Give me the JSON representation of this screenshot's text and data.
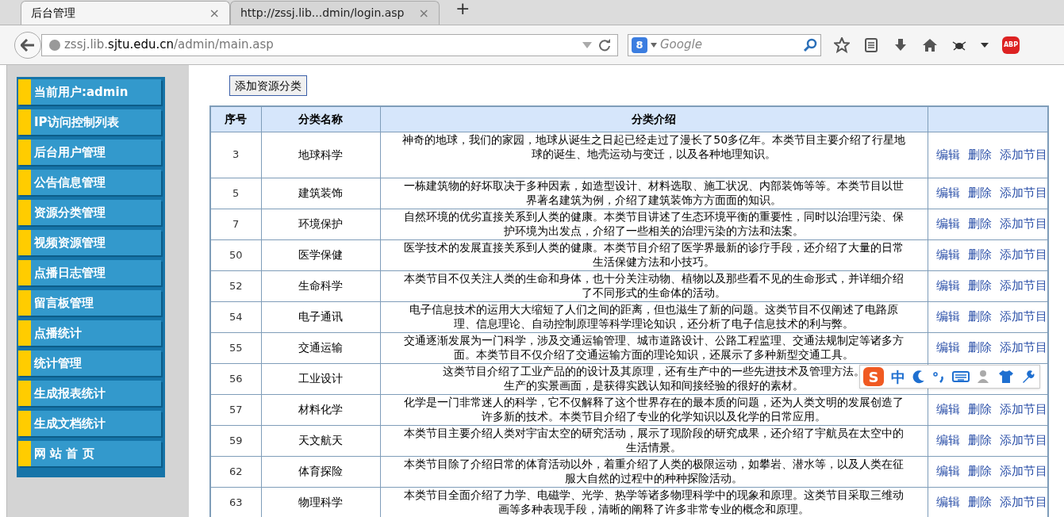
{
  "browser": {
    "tabs": [
      {
        "title": "后台管理",
        "selected": true,
        "close": "×"
      },
      {
        "title": "http://zssj.lib...dmin/login.asp",
        "selected": false,
        "close": "×"
      }
    ],
    "new_tab": "+",
    "address": {
      "prefix": "zssj.lib.",
      "domain": "sjtu.edu.cn",
      "path": "/admin/main.asp"
    },
    "search": {
      "engine": "8",
      "placeholder": "Google"
    },
    "adblock": "ABP"
  },
  "sidebar": {
    "items": [
      "当前用户:admin",
      "IP访问控制列表",
      "后台用户管理",
      "公告信息管理",
      "资源分类管理",
      "视频资源管理",
      "点播日志管理",
      "留言板管理",
      "点播统计",
      "统计管理",
      "生成报表统计",
      "生成文档统计",
      "网 站 首 页"
    ]
  },
  "add_button": "添加资源分类",
  "table": {
    "columns": [
      "序号",
      "分类名称",
      "分类介绍"
    ],
    "rows": [
      {
        "id": "3",
        "name": "地球科学",
        "lines": [
          "神奇的地球，我们的家园，地球从诞生之日起已经走过了漫长了50多亿年。本类节目主要介绍了行星地",
          "球的诞生、地壳运动与变迁，以及各种地理知识。"
        ],
        "actions": [
          "编辑",
          "删除",
          "添加节目"
        ]
      },
      {
        "id": "5",
        "name": "建筑装饰",
        "lines": [
          "一栋建筑物的好坏取决于多种因素，如造型设计、材料选取、施工状况、内部装饰等等。本类节目以世",
          "界著名建筑为例，介绍了建筑装饰方方面面的知识。"
        ],
        "actions": [
          "编辑",
          "删除",
          "添加节目"
        ]
      },
      {
        "id": "7",
        "name": "环境保护",
        "lines": [
          "自然环境的优劣直接关系到人类的健康。本类节目讲述了生态环境平衡的重要性，同时以治理污染、保",
          "护环境为出发点，介绍了一些相关的治理污染的方法和法案。"
        ],
        "actions": [
          "编辑",
          "删除",
          "添加节目"
        ]
      },
      {
        "id": "50",
        "name": "医学保健",
        "lines": [
          "医学技术的发展直接关系到人类的健康。本类节目介绍了医学界最新的诊疗手段，还介绍了大量的日常",
          "生活保健方法和小技巧。"
        ],
        "actions": [
          "编辑",
          "删除",
          "添加节目"
        ]
      },
      {
        "id": "52",
        "name": "生命科学",
        "lines": [
          "本类节目不仅关注人类的生命和身体，也十分关注动物、植物以及那些看不见的生命形式，并详细介绍",
          "了不同形式的生命体的活动。"
        ],
        "actions": [
          "编辑",
          "删除",
          "添加节目"
        ]
      },
      {
        "id": "54",
        "name": "电子通讯",
        "lines": [
          "电子信息技术的运用大大缩短了人们之间的距离，但也滋生了新的问题。这类节目不仅阐述了电路原",
          "理、信息理论、自动控制原理等科学理论知识，还分析了电子信息技术的利与弊。"
        ],
        "actions": [
          "编辑",
          "删除",
          "添加节目"
        ]
      },
      {
        "id": "55",
        "name": "交通运输",
        "lines": [
          "交通逐渐发展为一门科学，涉及交通运输管理、城市道路设计、公路工程监理、交通法规制定等诸多方",
          "面。本类节目不仅介绍了交通运输方面的理论知识，还展示了多种新型交通工具。"
        ],
        "actions": [
          "编辑",
          "删除",
          "添加节目"
        ]
      },
      {
        "id": "56",
        "name": "工业设计",
        "lines": [
          "这类节目介绍了工业产品的的设计及其原理，还有生产中的一些先进技术及管理方法。",
          "生产的实景画面，是获得实践认知和间接经验的很好的素材。"
        ]
      },
      {
        "id": "57",
        "name": "材料化学",
        "lines": [
          "化学是一门非常迷人的科学，它不仅解释了这个世界存在的最本质的问题，还为人类文明的发展创造了",
          "许多新的技术。本类节目介绍了专业的化学知识以及化学的日常应用。"
        ],
        "actions": [
          "编辑",
          "删除",
          "添加节目"
        ]
      },
      {
        "id": "59",
        "name": "天文航天",
        "lines": [
          "本类节目主要介绍人类对宇宙太空的研究活动，展示了现阶段的研究成果，还介绍了宇航员在太空中的",
          "生活情景。"
        ],
        "actions": [
          "编辑",
          "删除",
          "添加节目"
        ]
      },
      {
        "id": "62",
        "name": "体育探险",
        "lines": [
          "本类节目除了介绍日常的体育活动以外，着重介绍了人类的极限运动，如攀岩、潜水等，以及人类在征",
          "服大自然的过程中的种种探险活动。"
        ],
        "actions": [
          "编辑",
          "删除",
          "添加节目"
        ]
      },
      {
        "id": "63",
        "name": "物理科学",
        "lines": [
          "本类节目全面介绍了力学、电磁学、光学、热学等诸多物理科学中的现象和原理。这类节目采取三维动",
          "画等多种表现手段，清晰的阐释了许多非常专业的概念和原理。"
        ],
        "actions": [
          "编辑",
          "删除",
          "添加节目"
        ]
      }
    ]
  },
  "ime_toolbar": {
    "logo": "S",
    "mode": "中"
  }
}
